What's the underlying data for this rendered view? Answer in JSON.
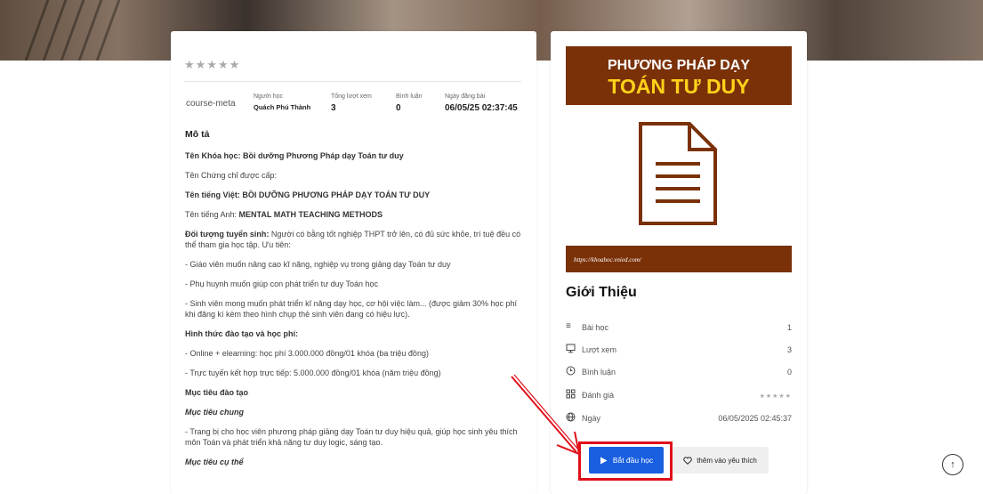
{
  "course": {
    "rating_stars": "★★★★★",
    "image_alt": "course-meta",
    "meta": {
      "student_label": "Người học",
      "student_value": "Quách Phú Thành",
      "views_label": "Tổng lượt xem",
      "views_value": "3",
      "comments_label": "Bình luận",
      "comments_value": "0",
      "posted_label": "Ngày đăng bài",
      "posted_value": "06/05/25 02:37:45"
    },
    "description": {
      "heading": "Mô tả",
      "course_name": "Tên Khóa học: Bồi dưỡng Phương Pháp dạy Toán tư duy",
      "certificate": "Tên Chứng chỉ được cấp:",
      "vn_name": "Tên tiếng Việt: BỒI DƯỠNG PHƯƠNG PHÁP DẠY TOÁN TƯ DUY",
      "en_name_label": "Tên tiếng Anh: ",
      "en_name_value": "MENTAL MATH TEACHING METHODS",
      "target_label": "Đối tượng tuyển sinh:",
      "target_text": " Người có bằng tốt nghiệp THPT trở lên, có đủ sức khỏe, trí tuệ đều có thể tham gia học tập. Ưu tiên:",
      "priority_1": "- Giáo viên muốn nâng cao kĩ năng, nghiệp vụ trong giảng dạy Toán tư duy",
      "priority_2": "- Phụ huynh muốn giúp con phát triển tư duy Toán học",
      "priority_3": "- Sinh viên mong muốn phát triển kĩ năng dạy học, cơ hội việc làm... (được giảm 30% học phí khi đăng kí kèm theo hình chụp thẻ sinh viên đang có hiệu lực).",
      "fee_heading": "Hình thức đào tạo và học phí:",
      "fee_1": "- Online + elearning: học phí 3.000.000 đồng/01 khóa (ba triệu đồng)",
      "fee_2": "- Trực tuyến kết hợp trực tiếp: 5.000.000 đồng/01 khóa (năm triệu đồng)",
      "goals_heading": "Mục tiêu đào tạo",
      "general_goal_heading": "Mục tiêu chung",
      "general_goal_text": "- Trang bị cho học viên phương pháp giảng dạy Toán tư duy hiệu quả, giúp học sinh yêu thích môn Toán và phát triển khả năng tư duy logic, sáng tạo.",
      "specific_goal_heading": "Mục tiêu cụ thể"
    }
  },
  "sidebar": {
    "banner_line1": "PHƯƠNG PHÁP DẠY",
    "banner_line2": "TOÁN TƯ DUY",
    "url_text": "https://khoahoc.vnied.com/",
    "intro_title": "Giới Thiệu",
    "rows": [
      {
        "icon": "list-icon",
        "label": "Bài học",
        "value": "1"
      },
      {
        "icon": "monitor-icon",
        "label": "Lượt xem",
        "value": "3"
      },
      {
        "icon": "clock-icon",
        "label": "Bình luận",
        "value": "0"
      },
      {
        "icon": "grid-icon",
        "label": "Đánh giá",
        "value": "★★★★★"
      },
      {
        "icon": "globe-icon",
        "label": "Ngày",
        "value": "06/05/2025 02:45:37"
      }
    ],
    "start_button": "Bắt đầu học",
    "favorite_button": "thêm vào yêu thích"
  },
  "colors": {
    "banner_bg": "#7a3108",
    "banner_accent": "#ffd21a",
    "start_button": "#1a5fe0",
    "highlight": "#e0101a"
  }
}
